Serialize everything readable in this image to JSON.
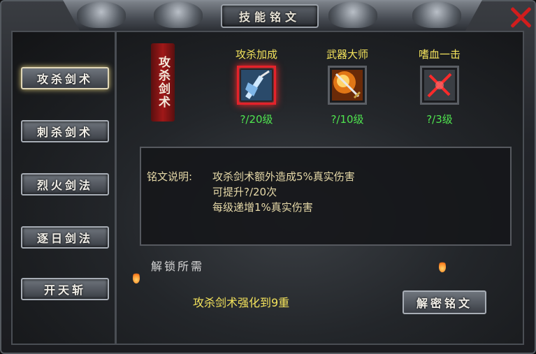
{
  "window": {
    "title": "技能铭文"
  },
  "sidebar": {
    "items": [
      {
        "label": "攻杀剑术"
      },
      {
        "label": "刺杀剑术"
      },
      {
        "label": "烈火剑法"
      },
      {
        "label": "逐日剑法"
      },
      {
        "label": "开天斩"
      }
    ],
    "active_index": 0
  },
  "banner": {
    "label": "攻杀剑术"
  },
  "skills": [
    {
      "name": "攻杀加成",
      "level": "?/20级",
      "icon": "ice-sword-icon",
      "selected": true
    },
    {
      "name": "武器大师",
      "level": "?/10级",
      "icon": "flame-sword-icon",
      "selected": false
    },
    {
      "name": "嗜血一击",
      "level": "?/3级",
      "icon": "blood-slash-icon",
      "selected": false
    }
  ],
  "description": {
    "label": "铭文说明:",
    "lines": [
      "攻杀剑术额外造成5%真实伤害",
      "可提升?/20次",
      "每级递增1%真实伤害"
    ]
  },
  "unlock": {
    "title": "解锁所需",
    "requirement": "攻杀剑术强化到9重",
    "button_label": "解密铭文"
  },
  "colors": {
    "accent_yellow": "#f4e35c",
    "level_green": "#4fe44f",
    "select_red": "#e5222a"
  }
}
